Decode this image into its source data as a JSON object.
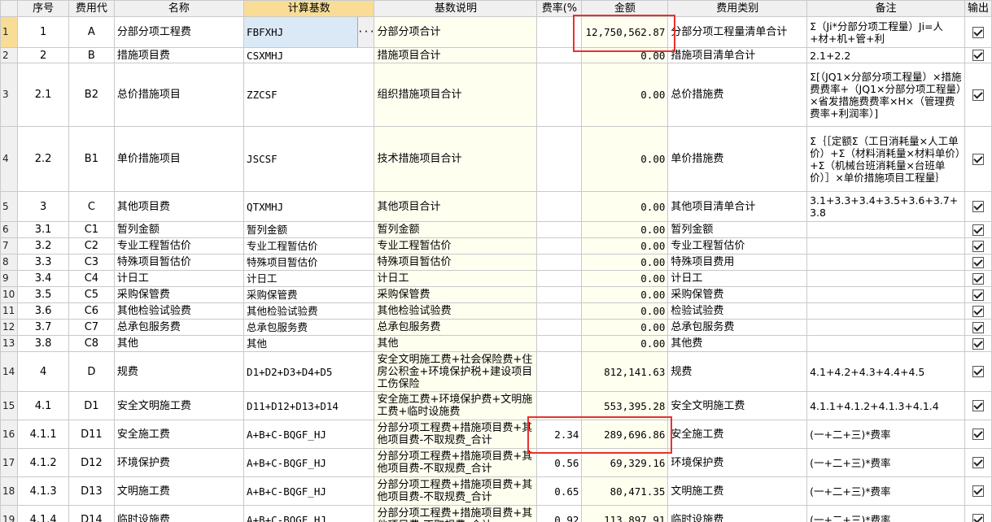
{
  "columns": [
    "序号",
    "费用代",
    "名称",
    "计算基数",
    "基数说明",
    "费率(%",
    "金额",
    "费用类别",
    "备注",
    "输出"
  ],
  "rows": [
    {
      "rownum": "1",
      "seq": "1",
      "code": "A",
      "name": "分部分项工程费",
      "base": "FBFXHJ",
      "desc": "分部分项合计",
      "rate": "",
      "amount": "12,750,562.87",
      "category": "分部分项工程量清单合计",
      "remark": "Σ（Ji*分部分项工程量）Ji=人+材+机+管+利",
      "output": true
    },
    {
      "rownum": "2",
      "seq": "2",
      "code": "B",
      "name": "措施项目费",
      "base": "CSXMHJ",
      "desc": "措施项目合计",
      "rate": "",
      "amount": "0.00",
      "category": "措施项目清单合计",
      "remark": "2.1+2.2",
      "output": true
    },
    {
      "rownum": "3",
      "seq": "2.1",
      "code": "B2",
      "name": "总价措施项目",
      "base": "ZZCSF",
      "desc": "组织措施项目合计",
      "rate": "",
      "amount": "0.00",
      "category": "总价措施费",
      "remark": "Σ[（JQ1×分部分项工程量）×措施费费率+（JQ1×分部分项工程量）×省发措施费费率×H×（管理费费率+利润率）]",
      "output": true
    },
    {
      "rownum": "4",
      "seq": "2.2",
      "code": "B1",
      "name": "单价措施项目",
      "base": "JSCSF",
      "desc": "技术措施项目合计",
      "rate": "",
      "amount": "0.00",
      "category": "单价措施费",
      "remark": "Σ｛［定额Σ（工日消耗量×人工单价）+Σ（材料消耗量×材料单价）+Σ（机械台班消耗量×台班单价）］×单价措施项目工程量｝",
      "output": true
    },
    {
      "rownum": "5",
      "seq": "3",
      "code": "C",
      "name": "其他项目费",
      "base": "QTXMHJ",
      "desc": "其他项目合计",
      "rate": "",
      "amount": "0.00",
      "category": "其他项目清单合计",
      "remark": "3.1+3.3+3.4+3.5+3.6+3.7+3.8",
      "output": true
    },
    {
      "rownum": "6",
      "seq": "3.1",
      "code": "C1",
      "name": "暂列金额",
      "base": "暂列金额",
      "desc": "暂列金额",
      "rate": "",
      "amount": "0.00",
      "category": "暂列金额",
      "remark": "",
      "output": true
    },
    {
      "rownum": "7",
      "seq": "3.2",
      "code": "C2",
      "name": "专业工程暂估价",
      "base": "专业工程暂估价",
      "desc": "专业工程暂估价",
      "rate": "",
      "amount": "0.00",
      "category": "专业工程暂估价",
      "remark": "",
      "output": true
    },
    {
      "rownum": "8",
      "seq": "3.3",
      "code": "C3",
      "name": "特殊项目暂估价",
      "base": "特殊项目暂估价",
      "desc": "特殊项目暂估价",
      "rate": "",
      "amount": "0.00",
      "category": "特殊项目费用",
      "remark": "",
      "output": true
    },
    {
      "rownum": "9",
      "seq": "3.4",
      "code": "C4",
      "name": "计日工",
      "base": "计日工",
      "desc": "计日工",
      "rate": "",
      "amount": "0.00",
      "category": "计日工",
      "remark": "",
      "output": true
    },
    {
      "rownum": "10",
      "seq": "3.5",
      "code": "C5",
      "name": "采购保管费",
      "base": "采购保管费",
      "desc": "采购保管费",
      "rate": "",
      "amount": "0.00",
      "category": "采购保管费",
      "remark": "",
      "output": true
    },
    {
      "rownum": "11",
      "seq": "3.6",
      "code": "C6",
      "name": "其他检验试验费",
      "base": "其他检验试验费",
      "desc": "其他检验试验费",
      "rate": "",
      "amount": "0.00",
      "category": "检验试验费",
      "remark": "",
      "output": true
    },
    {
      "rownum": "12",
      "seq": "3.7",
      "code": "C7",
      "name": "总承包服务费",
      "base": "总承包服务费",
      "desc": "总承包服务费",
      "rate": "",
      "amount": "0.00",
      "category": "总承包服务费",
      "remark": "",
      "output": true
    },
    {
      "rownum": "13",
      "seq": "3.8",
      "code": "C8",
      "name": "其他",
      "base": "其他",
      "desc": "其他",
      "rate": "",
      "amount": "0.00",
      "category": "其他费",
      "remark": "",
      "output": true
    },
    {
      "rownum": "14",
      "seq": "4",
      "code": "D",
      "name": "规费",
      "base": "D1+D2+D3+D4+D5",
      "desc": "安全文明施工费+社会保险费+住房公积金+环境保护税+建设项目工伤保险",
      "rate": "",
      "amount": "812,141.63",
      "category": "规费",
      "remark": "4.1+4.2+4.3+4.4+4.5",
      "output": true
    },
    {
      "rownum": "15",
      "seq": "4.1",
      "code": "D1",
      "name": "安全文明施工费",
      "base": "D11+D12+D13+D14",
      "desc": "安全施工费+环境保护费+文明施工费+临时设施费",
      "rate": "",
      "amount": "553,395.28",
      "category": "安全文明施工费",
      "remark": "4.1.1+4.1.2+4.1.3+4.1.4",
      "output": true
    },
    {
      "rownum": "16",
      "seq": "4.1.1",
      "code": "D11",
      "name": "安全施工费",
      "base": "A+B+C-BQGF_HJ",
      "desc": "分部分项工程费+措施项目费+其他项目费-不取规费_合计",
      "rate": "2.34",
      "amount": "289,696.86",
      "category": "安全施工费",
      "remark": "(一+二+三)*费率",
      "output": true
    },
    {
      "rownum": "17",
      "seq": "4.1.2",
      "code": "D12",
      "name": "环境保护费",
      "base": "A+B+C-BQGF_HJ",
      "desc": "分部分项工程费+措施项目费+其他项目费-不取规费_合计",
      "rate": "0.56",
      "amount": "69,329.16",
      "category": "环境保护费",
      "remark": "(一+二+三)*费率",
      "output": true
    },
    {
      "rownum": "18",
      "seq": "4.1.3",
      "code": "D13",
      "name": "文明施工费",
      "base": "A+B+C-BQGF_HJ",
      "desc": "分部分项工程费+措施项目费+其他项目费-不取规费_合计",
      "rate": "0.65",
      "amount": "80,471.35",
      "category": "文明施工费",
      "remark": "(一+二+三)*费率",
      "output": true
    },
    {
      "rownum": "19",
      "seq": "4.1.4",
      "code": "D14",
      "name": "临时设施费",
      "base": "A+B+C-BQGF_HJ",
      "desc": "分部分项工程费+措施项目费+其他项目费-不取规费_合计",
      "rate": "0.92",
      "amount": "113,897.91",
      "category": "临时设施费",
      "remark": "(一+二+三)*费率",
      "output": true
    }
  ],
  "colors": {
    "header_bg": "#f0f0f0",
    "selected_header": "#f9dd96",
    "selected_cell": "#dbe9f7",
    "highlight_box": "#e8312f",
    "desc_bg": "#fffff0"
  },
  "icons": {
    "ellipsis_button": "ellipsis-icon",
    "checkbox": "checkbox-checked-icon"
  }
}
